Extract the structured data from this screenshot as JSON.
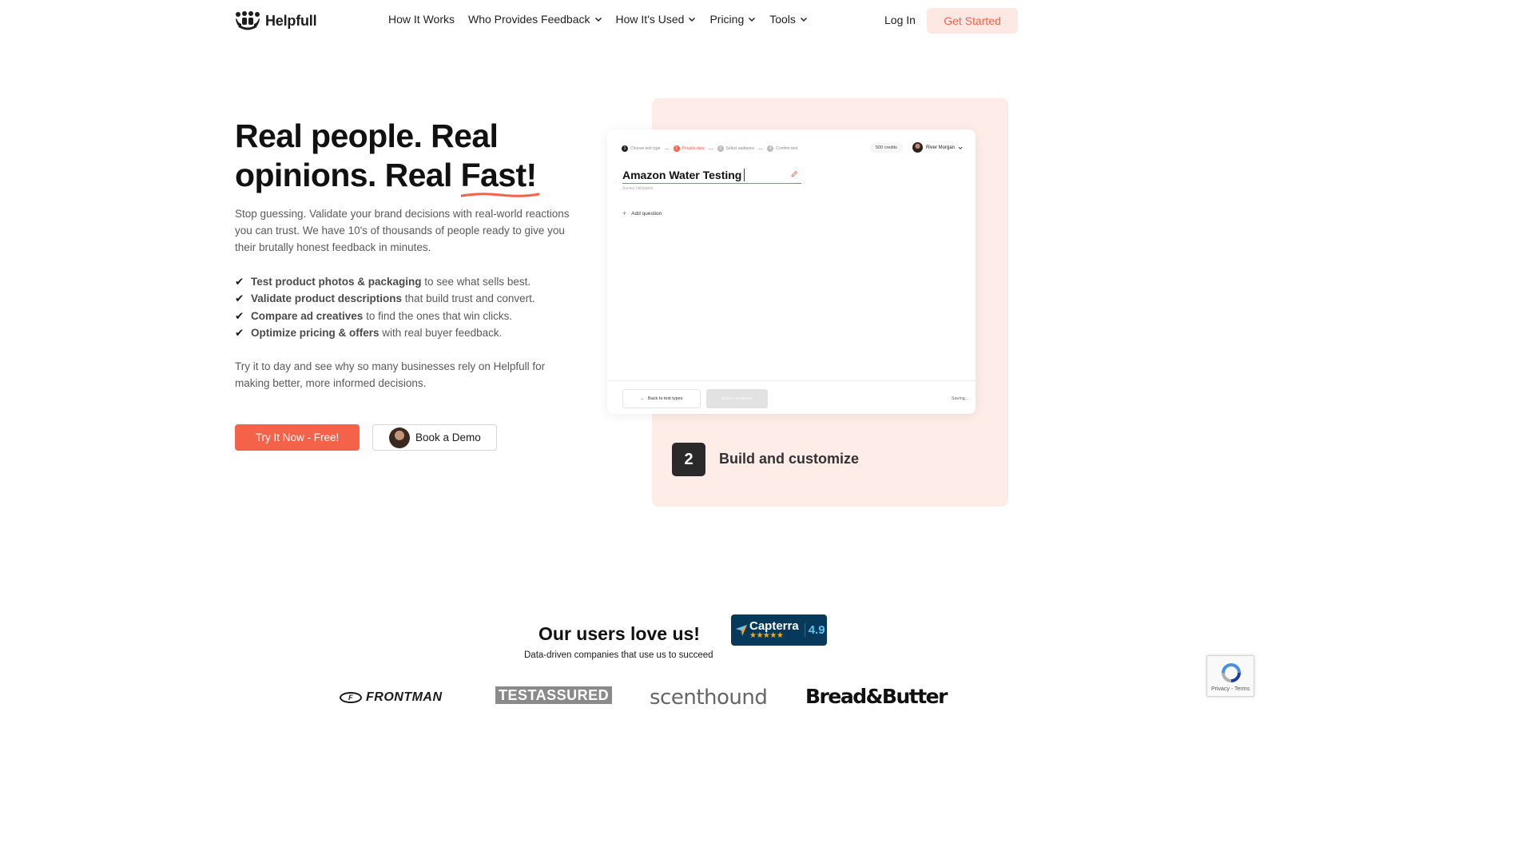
{
  "header": {
    "logo_text": "Helpfull",
    "nav": [
      {
        "label": "How It Works",
        "has_dropdown": false
      },
      {
        "label": "Who Provides Feedback",
        "has_dropdown": true
      },
      {
        "label": "How It's Used",
        "has_dropdown": true
      },
      {
        "label": "Pricing",
        "has_dropdown": true
      },
      {
        "label": "Tools",
        "has_dropdown": true
      }
    ],
    "login_label": "Log In",
    "cta_label": "Get Started"
  },
  "hero": {
    "title_line1": "Real people. Real",
    "title_line2_prefix": "opinions. Real ",
    "title_highlight": "Fast!",
    "subtitle": "Stop guessing. Validate your brand decisions with real-world reactions you can trust. We have 10's of thousands of people ready to give you their brutally honest feedback in minutes.",
    "bullets": [
      {
        "check": "✔",
        "bold": "Test product photos & packaging",
        "rest": " to see what sells best."
      },
      {
        "check": "✔",
        "bold": "Validate product descriptions",
        "rest": " that build trust and convert."
      },
      {
        "check": "✔",
        "bold": "Compare ad creatives",
        "rest": " to find the ones that win clicks."
      },
      {
        "check": "✔",
        "bold": "Optimize pricing & offers",
        "rest": " with real buyer feedback."
      }
    ],
    "try_text": "Try it to day and see why so many businesses rely on Helpfull for making better, more informed decisions.",
    "primary_button": "Try It Now - Free!",
    "demo_button": "Book a Demo"
  },
  "app_preview": {
    "steps": [
      {
        "num": "1",
        "label": "Choose test type",
        "state": "done"
      },
      {
        "num": "2",
        "label": "Provide data",
        "state": "active"
      },
      {
        "num": "3",
        "label": "Select audience",
        "state": "pending"
      },
      {
        "num": "4",
        "label": "Confirm test",
        "state": "pending"
      }
    ],
    "credits": "500 credits",
    "user_name": "River Morgan",
    "survey_name": "Amazon Water Testing",
    "survey_hint": "Survey nickname",
    "add_question": "Add question",
    "back_button": "Back to test types",
    "next_button": "Select audience",
    "status": "Saving..."
  },
  "feature_step": {
    "number": "2",
    "title": "Build and customize"
  },
  "social_proof": {
    "heading": "Our users love us!",
    "capterra_name": "Capterra",
    "capterra_stars": "★★★★★",
    "capterra_rating": "4.9",
    "subheading": "Data-driven companies that use us to succeed",
    "brands": {
      "frontman_badge": "F",
      "frontman": "FRONTMAN",
      "test_assured": "TESTASSURED",
      "scenthound": "scenthound",
      "bread_butter": "Bread&Butter"
    }
  },
  "recaptcha": {
    "text": "Privacy - Terms"
  },
  "colors": {
    "accent": "#f4624a",
    "accent_light": "#fde8e4",
    "panel_pink": "#fdece8",
    "capterra_bg": "#073a5a"
  }
}
